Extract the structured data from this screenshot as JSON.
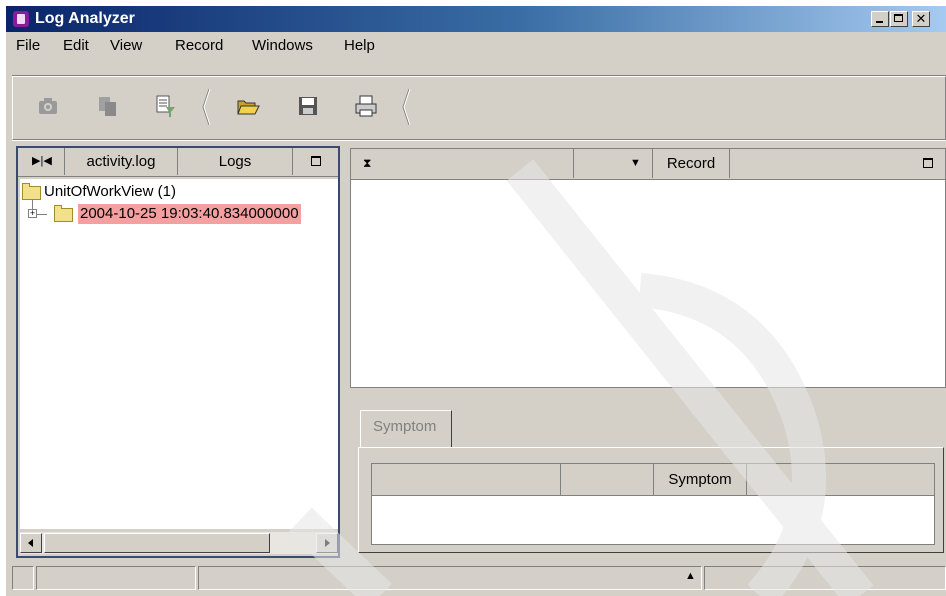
{
  "window": {
    "title": "Log Analyzer",
    "controls": [
      "minimize",
      "maximize",
      "close"
    ]
  },
  "menu": [
    "File",
    "Edit",
    "View",
    "Record",
    "Windows",
    "Help"
  ],
  "toolbar": {
    "buttons": [
      "camera-icon",
      "copy-icon",
      "filter-icon",
      "open-folder-icon",
      "save-icon",
      "print-icon"
    ]
  },
  "left_pane": {
    "header": {
      "nav_icon": "first-last-icon",
      "file": "activity.log",
      "title": "Logs",
      "maximize_icon": "maximize-icon"
    },
    "tree": {
      "root_label": "UnitOfWorkView (1)",
      "child_label": "2004-10-25 19:03:40.834000000"
    }
  },
  "right_pane": {
    "header": {
      "sort_icon": "sort-icon",
      "dropdown_icon": "chevron-down-icon",
      "title": "Record",
      "maximize_icon": "maximize-icon"
    }
  },
  "symptom_panel": {
    "tab_label": "Symptom",
    "columns": [
      "",
      "",
      "Symptom",
      ""
    ]
  },
  "status_bar": {
    "arrow_icon": "up-arrow-icon"
  },
  "colors": {
    "titlebar_start": "#0a246a",
    "titlebar_end": "#a6caf0",
    "window_bg": "#d4d0c8",
    "selected_row": "#f4a0a0",
    "pane_border": "#3a4a73"
  }
}
